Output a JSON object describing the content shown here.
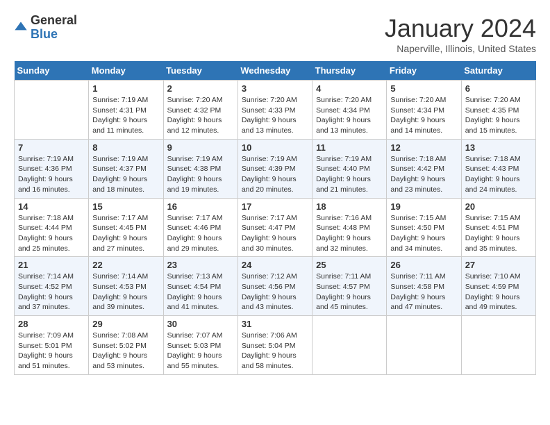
{
  "header": {
    "logo_general": "General",
    "logo_blue": "Blue",
    "month_title": "January 2024",
    "location": "Naperville, Illinois, United States"
  },
  "days_of_week": [
    "Sunday",
    "Monday",
    "Tuesday",
    "Wednesday",
    "Thursday",
    "Friday",
    "Saturday"
  ],
  "weeks": [
    [
      {
        "day": "",
        "info": ""
      },
      {
        "day": "1",
        "info": "Sunrise: 7:19 AM\nSunset: 4:31 PM\nDaylight: 9 hours\nand 11 minutes."
      },
      {
        "day": "2",
        "info": "Sunrise: 7:20 AM\nSunset: 4:32 PM\nDaylight: 9 hours\nand 12 minutes."
      },
      {
        "day": "3",
        "info": "Sunrise: 7:20 AM\nSunset: 4:33 PM\nDaylight: 9 hours\nand 13 minutes."
      },
      {
        "day": "4",
        "info": "Sunrise: 7:20 AM\nSunset: 4:34 PM\nDaylight: 9 hours\nand 13 minutes."
      },
      {
        "day": "5",
        "info": "Sunrise: 7:20 AM\nSunset: 4:34 PM\nDaylight: 9 hours\nand 14 minutes."
      },
      {
        "day": "6",
        "info": "Sunrise: 7:20 AM\nSunset: 4:35 PM\nDaylight: 9 hours\nand 15 minutes."
      }
    ],
    [
      {
        "day": "7",
        "info": "Sunrise: 7:19 AM\nSunset: 4:36 PM\nDaylight: 9 hours\nand 16 minutes."
      },
      {
        "day": "8",
        "info": "Sunrise: 7:19 AM\nSunset: 4:37 PM\nDaylight: 9 hours\nand 18 minutes."
      },
      {
        "day": "9",
        "info": "Sunrise: 7:19 AM\nSunset: 4:38 PM\nDaylight: 9 hours\nand 19 minutes."
      },
      {
        "day": "10",
        "info": "Sunrise: 7:19 AM\nSunset: 4:39 PM\nDaylight: 9 hours\nand 20 minutes."
      },
      {
        "day": "11",
        "info": "Sunrise: 7:19 AM\nSunset: 4:40 PM\nDaylight: 9 hours\nand 21 minutes."
      },
      {
        "day": "12",
        "info": "Sunrise: 7:18 AM\nSunset: 4:42 PM\nDaylight: 9 hours\nand 23 minutes."
      },
      {
        "day": "13",
        "info": "Sunrise: 7:18 AM\nSunset: 4:43 PM\nDaylight: 9 hours\nand 24 minutes."
      }
    ],
    [
      {
        "day": "14",
        "info": "Sunrise: 7:18 AM\nSunset: 4:44 PM\nDaylight: 9 hours\nand 25 minutes."
      },
      {
        "day": "15",
        "info": "Sunrise: 7:17 AM\nSunset: 4:45 PM\nDaylight: 9 hours\nand 27 minutes."
      },
      {
        "day": "16",
        "info": "Sunrise: 7:17 AM\nSunset: 4:46 PM\nDaylight: 9 hours\nand 29 minutes."
      },
      {
        "day": "17",
        "info": "Sunrise: 7:17 AM\nSunset: 4:47 PM\nDaylight: 9 hours\nand 30 minutes."
      },
      {
        "day": "18",
        "info": "Sunrise: 7:16 AM\nSunset: 4:48 PM\nDaylight: 9 hours\nand 32 minutes."
      },
      {
        "day": "19",
        "info": "Sunrise: 7:15 AM\nSunset: 4:50 PM\nDaylight: 9 hours\nand 34 minutes."
      },
      {
        "day": "20",
        "info": "Sunrise: 7:15 AM\nSunset: 4:51 PM\nDaylight: 9 hours\nand 35 minutes."
      }
    ],
    [
      {
        "day": "21",
        "info": "Sunrise: 7:14 AM\nSunset: 4:52 PM\nDaylight: 9 hours\nand 37 minutes."
      },
      {
        "day": "22",
        "info": "Sunrise: 7:14 AM\nSunset: 4:53 PM\nDaylight: 9 hours\nand 39 minutes."
      },
      {
        "day": "23",
        "info": "Sunrise: 7:13 AM\nSunset: 4:54 PM\nDaylight: 9 hours\nand 41 minutes."
      },
      {
        "day": "24",
        "info": "Sunrise: 7:12 AM\nSunset: 4:56 PM\nDaylight: 9 hours\nand 43 minutes."
      },
      {
        "day": "25",
        "info": "Sunrise: 7:11 AM\nSunset: 4:57 PM\nDaylight: 9 hours\nand 45 minutes."
      },
      {
        "day": "26",
        "info": "Sunrise: 7:11 AM\nSunset: 4:58 PM\nDaylight: 9 hours\nand 47 minutes."
      },
      {
        "day": "27",
        "info": "Sunrise: 7:10 AM\nSunset: 4:59 PM\nDaylight: 9 hours\nand 49 minutes."
      }
    ],
    [
      {
        "day": "28",
        "info": "Sunrise: 7:09 AM\nSunset: 5:01 PM\nDaylight: 9 hours\nand 51 minutes."
      },
      {
        "day": "29",
        "info": "Sunrise: 7:08 AM\nSunset: 5:02 PM\nDaylight: 9 hours\nand 53 minutes."
      },
      {
        "day": "30",
        "info": "Sunrise: 7:07 AM\nSunset: 5:03 PM\nDaylight: 9 hours\nand 55 minutes."
      },
      {
        "day": "31",
        "info": "Sunrise: 7:06 AM\nSunset: 5:04 PM\nDaylight: 9 hours\nand 58 minutes."
      },
      {
        "day": "",
        "info": ""
      },
      {
        "day": "",
        "info": ""
      },
      {
        "day": "",
        "info": ""
      }
    ]
  ]
}
